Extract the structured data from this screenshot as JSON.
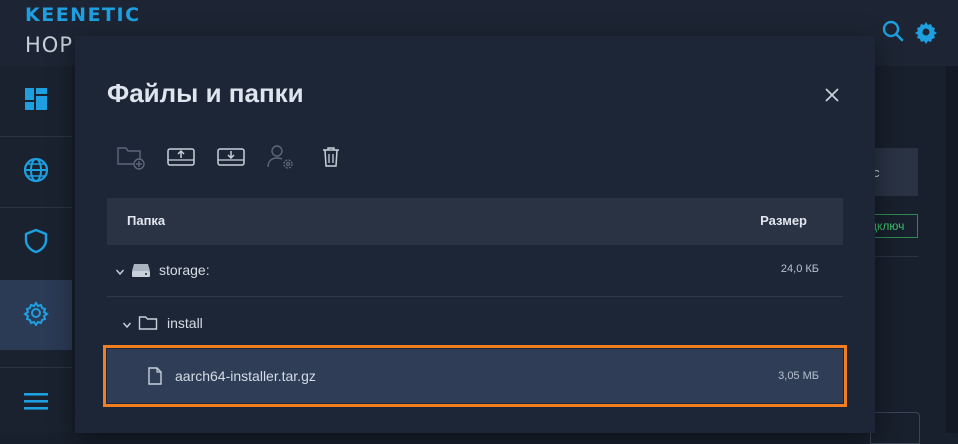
{
  "brand": {
    "line1": "KEENETIC",
    "line2": "HOP"
  },
  "icons": {
    "search": "search-icon",
    "settings": "gear-icon",
    "dashboard": "dashboard-icon",
    "internet": "globe-icon",
    "security": "shield-icon",
    "management": "gear-icon",
    "menu": "hamburger-icon"
  },
  "background": {
    "column_header": "с",
    "status_text": "дключ"
  },
  "modal": {
    "title": "Файлы и папки",
    "toolbar": [
      "folder-add-icon",
      "upload-icon",
      "download-icon",
      "user-settings-icon",
      "trash-icon"
    ],
    "table": {
      "col_folder": "Папка",
      "col_size": "Размер",
      "rows": [
        {
          "name": "storage:",
          "size": "24,0 КБ",
          "type": "drive",
          "expanded": true
        },
        {
          "name": "install",
          "size": "",
          "type": "folder",
          "expanded": true
        },
        {
          "name": "aarch64-installer.tar.gz",
          "size": "3,05 МБ",
          "type": "file",
          "selected": true
        }
      ]
    }
  },
  "colors": {
    "accent": "#1e9fe0",
    "selection_outline": "#f07e22",
    "status_green": "#3cc46b"
  }
}
